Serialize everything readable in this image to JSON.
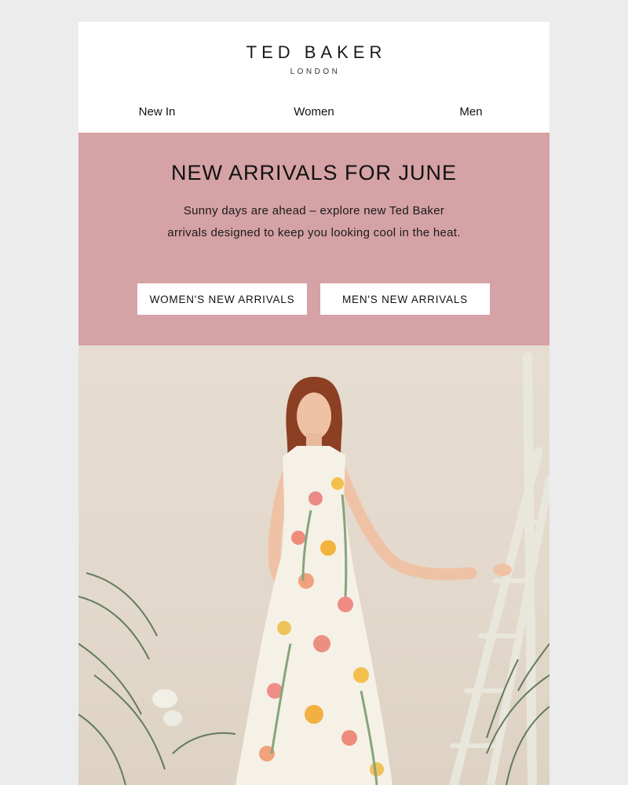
{
  "brand": {
    "name": "TED BAKER",
    "sub": "LONDON"
  },
  "nav": {
    "items": [
      {
        "label": "New In"
      },
      {
        "label": "Women"
      },
      {
        "label": "Men"
      }
    ]
  },
  "hero": {
    "title": "NEW ARRIVALS FOR JUNE",
    "body_line1": "Sunny days are ahead – explore new Ted Baker",
    "body_line2": "arrivals designed to keep you looking cool in the heat.",
    "buttons": [
      {
        "label": "WOMEN'S NEW ARRIVALS"
      },
      {
        "label": "MEN'S NEW ARRIVALS"
      }
    ],
    "background": "#d5a2a6"
  },
  "photo": {
    "icon": "model-in-floral-dress-photo"
  }
}
